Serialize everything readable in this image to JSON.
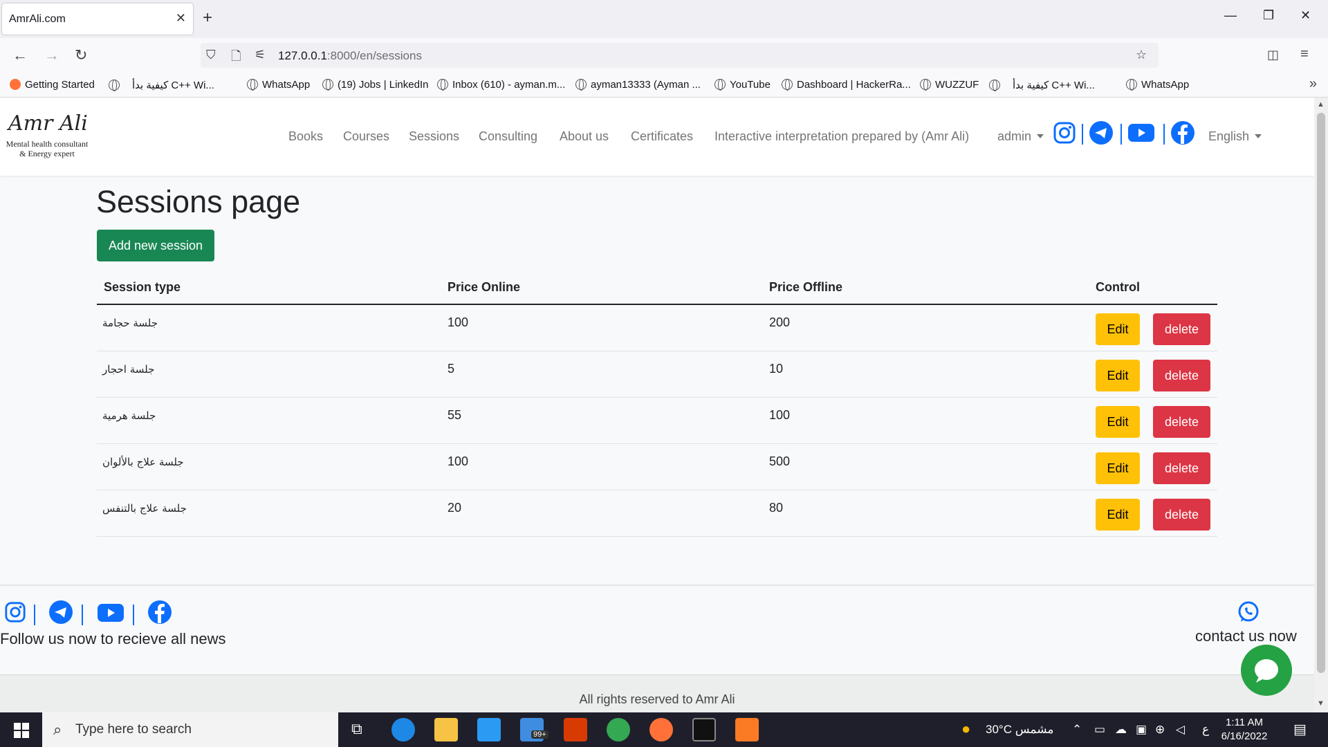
{
  "browser": {
    "tab_title": "AmrAli.com",
    "url_host": "127.0.0.1",
    "url_rest": ":8000/en/sessions",
    "bookmarks": [
      "Getting Started",
      "كيفية بدأ C++ Wi...",
      "WhatsApp",
      "(19) Jobs | LinkedIn",
      "Inbox (610) - ayman.m...",
      "ayman13333 (Ayman ...",
      "YouTube",
      "Dashboard | HackerRa...",
      "WUZZUF",
      "كيفية بدأ C++ Wi...",
      "WhatsApp"
    ]
  },
  "site": {
    "logo_name": "Amr Ali",
    "logo_line1": "Mental health consultant",
    "logo_line2": "& Energy expert",
    "menu": [
      "Books",
      "Courses",
      "Sessions",
      "Consulting",
      "About us",
      "Certificates",
      "Interactive interpretation prepared by (Amr Ali)"
    ],
    "user_menu": "admin",
    "language": "English"
  },
  "page": {
    "title": "Sessions page",
    "add_button": "Add new session",
    "columns": [
      "Session type",
      "Price Online",
      "Price Offline",
      "Control"
    ],
    "rows": [
      {
        "type": "جلسة حجامة",
        "online": "100",
        "offline": "200"
      },
      {
        "type": "جلسة احجار",
        "online": "5",
        "offline": "10"
      },
      {
        "type": "جلسة هرمية",
        "online": "55",
        "offline": "100"
      },
      {
        "type": "جلسة علاج بالألوان",
        "online": "100",
        "offline": "500"
      },
      {
        "type": "جلسة علاج بالتنفس",
        "online": "20",
        "offline": "80"
      }
    ],
    "edit_label": "Edit",
    "delete_label": "delete"
  },
  "footer": {
    "follow_text": "Follow us now to recieve all news",
    "contact_text": "contact us now",
    "copyright": "All rights reserved to Amr Ali"
  },
  "taskbar": {
    "search_placeholder": "Type here to search",
    "mail_badge": "99+",
    "weather": "30°C  مشمس",
    "lang": "ع",
    "time": "1:11 AM",
    "date": "6/16/2022"
  },
  "colors": {
    "primary": "#0d6efd",
    "success": "#198754",
    "warning": "#ffc107",
    "danger": "#dc3545",
    "instagram": "#0d6efd",
    "telegram": "#0d6efd",
    "youtube": "#0d6efd",
    "facebook": "#0d6efd",
    "whatsapp": "#25a244"
  }
}
